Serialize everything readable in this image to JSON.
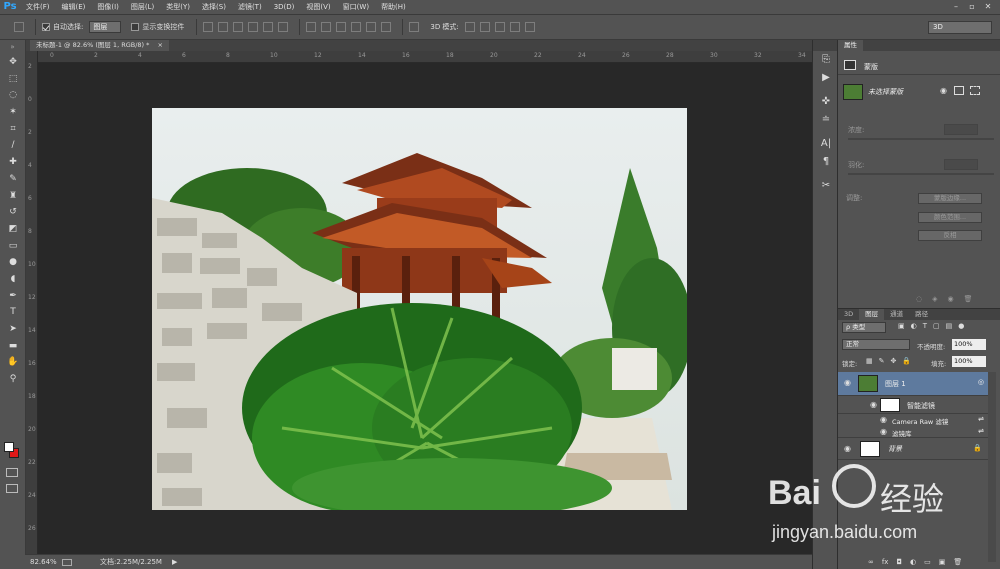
{
  "app_logo": "Ps",
  "menu": [
    "文件(F)",
    "编辑(E)",
    "图像(I)",
    "图层(L)",
    "类型(Y)",
    "选择(S)",
    "滤镜(T)",
    "3D(D)",
    "视图(V)",
    "窗口(W)",
    "帮助(H)"
  ],
  "window_controls": [
    "–",
    "▫",
    "✕"
  ],
  "options": {
    "auto_select_label": "自动选择:",
    "auto_select_value": "图层",
    "show_transform_label": "显示变换控件",
    "mode3d_label": "3D 模式:",
    "workspace": "3D"
  },
  "document": {
    "tab_title": "未标题-1 @ 82.6% (图层 1, RGB/8) *",
    "tab_close": "×",
    "zoom": "82.64%",
    "doc_size": "文档:2.25M/2.25M"
  },
  "rulers": {
    "top": [
      "0",
      "2",
      "4",
      "6",
      "8",
      "10",
      "12",
      "14",
      "16",
      "18",
      "20",
      "22",
      "24",
      "26",
      "28",
      "30",
      "32",
      "34"
    ],
    "left": [
      "2",
      "0",
      "2",
      "4",
      "6",
      "8",
      "10",
      "12",
      "14",
      "16",
      "18",
      "20",
      "22",
      "24",
      "26"
    ]
  },
  "properties": {
    "tab": "属性",
    "section": "蒙版",
    "mask_label": "未选择蒙版",
    "density_label": "浓度:",
    "feather_label": "羽化:",
    "adjust_label": "调整:",
    "btn_mask_edge": "蒙版边缘...",
    "btn_color_range": "颜色范围...",
    "btn_invert": "反相"
  },
  "layers_panel": {
    "tabs": [
      "3D",
      "图层",
      "通道",
      "路径"
    ],
    "filter_kind": "ρ 类型",
    "blend_mode": "正常",
    "opacity_label": "不透明度:",
    "opacity_value": "100%",
    "lock_label": "锁定:",
    "fill_label": "填充:",
    "fill_value": "100%",
    "layers": [
      {
        "name": "图层 1"
      },
      {
        "name": "智能滤镜"
      },
      {
        "name": "Camera Raw 滤镜"
      },
      {
        "name": "滤镜库"
      },
      {
        "name": "背景"
      }
    ]
  },
  "watermark": {
    "logo_text": "Bai",
    "logo_cn": "经验",
    "url": "jingyan.baidu.com"
  },
  "colors": {
    "ui_bg": "#535353",
    "canvas_bg": "#282828",
    "selected_layer": "#5e7a9e",
    "ps_blue": "#31a8ff"
  }
}
